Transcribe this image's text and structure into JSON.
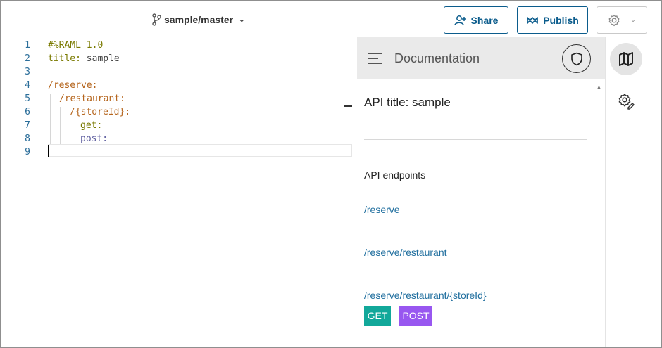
{
  "header": {
    "branch": "sample/master",
    "share_label": "Share",
    "publish_label": "Publish"
  },
  "editor": {
    "lines": [
      {
        "num": "1",
        "key": "#%RAML 1.0",
        "val": ""
      },
      {
        "num": "2",
        "key": "title:",
        "val": " sample"
      },
      {
        "num": "3",
        "key": "",
        "val": ""
      },
      {
        "num": "4",
        "key": "/reserve:",
        "val": ""
      },
      {
        "num": "5",
        "key": "/restaurant:",
        "val": ""
      },
      {
        "num": "6",
        "key": "/{storeId}:",
        "val": ""
      },
      {
        "num": "7",
        "key": "get:",
        "val": ""
      },
      {
        "num": "8",
        "key": "post:",
        "val": ""
      },
      {
        "num": "9",
        "key": "",
        "val": ""
      }
    ]
  },
  "documentation": {
    "heading": "Documentation",
    "api_title": "API title: sample",
    "endpoints_heading": "API endpoints",
    "endpoints": [
      "/reserve",
      "/reserve/restaurant",
      "/reserve/restaurant/{storeId}"
    ],
    "methods": [
      "GET",
      "POST"
    ]
  },
  "colors": {
    "accent": "#0b5c8c",
    "get": "#12a89a",
    "post": "#9857f0",
    "link": "#1f6e9e"
  },
  "icons": {
    "branch": "git-branch-icon",
    "share": "person-add-icon",
    "publish": "infinity-icon",
    "settings": "gear-icon",
    "menu": "hamburger-icon",
    "shield": "shield-icon",
    "docs_rail": "book-map-icon",
    "settings_rail": "gear-pencil-icon"
  }
}
